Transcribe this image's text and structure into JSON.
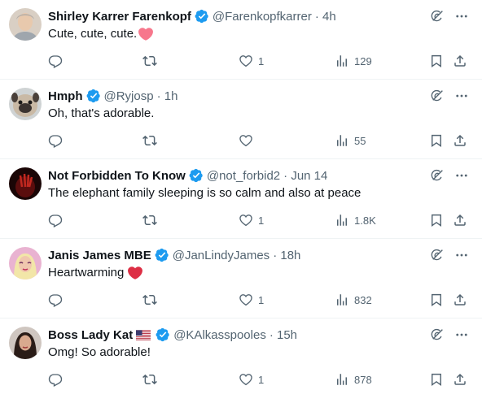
{
  "colors": {
    "verified": "#1d9bf0",
    "heart_emoji_pink": "#f7778c",
    "heart_emoji_red": "#dd2e44",
    "secondary_text": "#536471"
  },
  "icons": {
    "reply": "reply-icon",
    "retweet": "retweet-icon",
    "like": "like-icon",
    "views": "views-icon",
    "bookmark": "bookmark-icon",
    "share": "share-icon",
    "grok": "grok-icon",
    "more": "more-icon"
  },
  "tweets": [
    {
      "name": "Shirley Karrer Farenkopf",
      "handle": "@Farenkopfkarrer",
      "time": "· 4h",
      "text": "Cute, cute, cute.",
      "emoji": "pink-heart",
      "replies": "",
      "retweets": "",
      "likes": "1",
      "views": "129"
    },
    {
      "name": "Hmph",
      "handle": "@Ryjosp",
      "time": "· 1h",
      "text": "Oh, that's adorable.",
      "emoji": "",
      "replies": "",
      "retweets": "",
      "likes": "",
      "views": "55"
    },
    {
      "name": "Not Forbidden To Know",
      "handle": "@not_forbid2",
      "time": "· Jun 14",
      "text": "The elephant family sleeping is so calm and also at peace",
      "emoji": "",
      "replies": "",
      "retweets": "",
      "likes": "1",
      "views": "1.8K"
    },
    {
      "name": "Janis James MBE",
      "handle": "@JanLindyJames",
      "time": "· 18h",
      "text": "Heartwarming",
      "emoji": "red-heart",
      "replies": "",
      "retweets": "",
      "likes": "1",
      "views": "832"
    },
    {
      "name": "Boss Lady Kat",
      "handle": "@KAlkasspooles",
      "time": "· 15h",
      "text": "Omg! So adorable!",
      "emoji": "",
      "flag": "us-flag",
      "replies": "",
      "retweets": "",
      "likes": "1",
      "views": "878"
    }
  ]
}
